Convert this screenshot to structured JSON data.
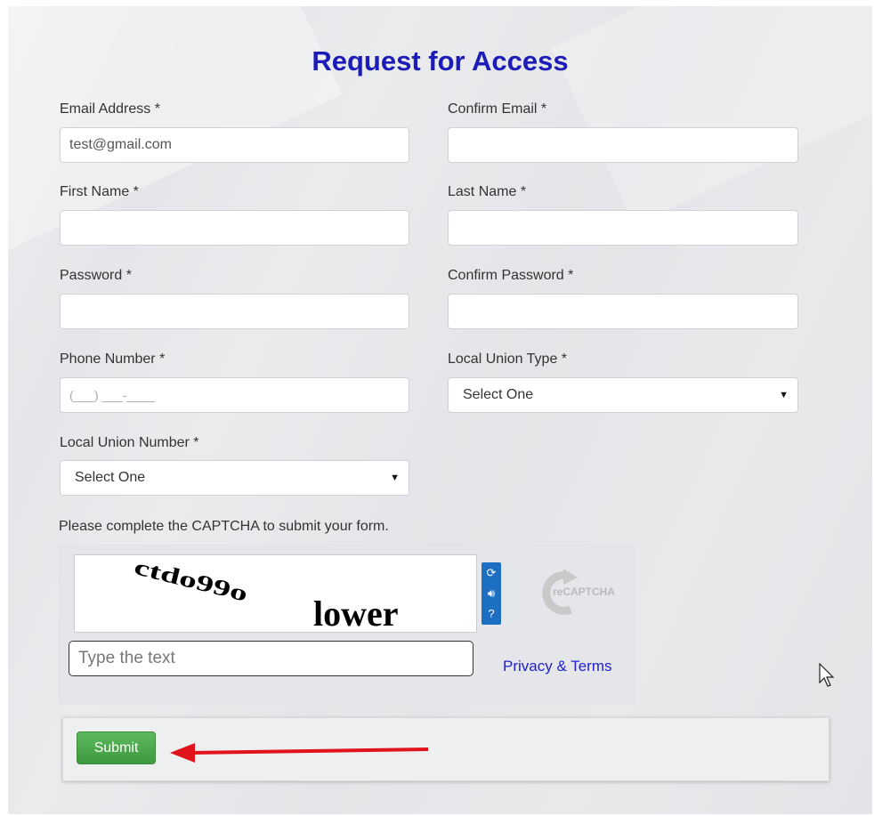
{
  "form": {
    "title": "Request for Access",
    "email": {
      "label": "Email Address *",
      "value": "test@gmail.com"
    },
    "confirm_email": {
      "label": "Confirm Email *",
      "value": ""
    },
    "first_name": {
      "label": "First Name *",
      "value": ""
    },
    "last_name": {
      "label": "Last Name *",
      "value": ""
    },
    "password": {
      "label": "Password *",
      "value": ""
    },
    "confirm_password": {
      "label": "Confirm Password *",
      "value": ""
    },
    "phone": {
      "label": "Phone Number *",
      "placeholder": "(___) ___-____"
    },
    "local_union_type": {
      "label": "Local Union Type *",
      "selected": "Select One"
    },
    "local_union_number": {
      "label": "Local Union Number *",
      "selected": "Select One"
    }
  },
  "captcha": {
    "note": "Please complete the CAPTCHA to submit your form.",
    "word_1": "ctdo99o",
    "word_2": "lower",
    "input_placeholder": "Type the text",
    "privacy_link": "Privacy & Terms",
    "brand": "reCAPTCHA",
    "buttons": [
      "refresh-icon",
      "audio-icon",
      "help-icon"
    ]
  },
  "submit": {
    "label": "Submit",
    "color": "#4cae4c"
  },
  "annotation": {
    "arrow_color": "#e0141a"
  }
}
